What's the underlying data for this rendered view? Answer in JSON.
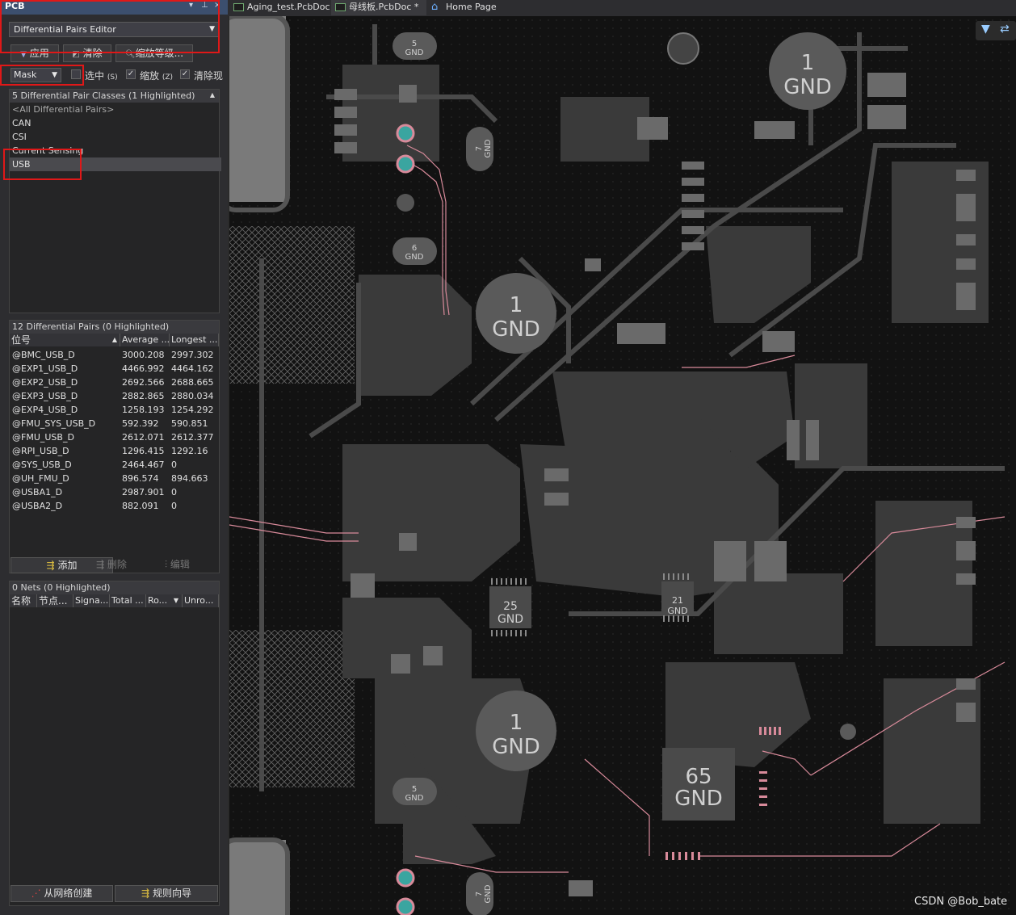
{
  "panel": {
    "title": "PCB",
    "mode_select": "Differential Pairs Editor",
    "buttons": {
      "apply": "应用",
      "clear": "清除",
      "zoom_level": "缩放等级..."
    },
    "mask_select": "Mask",
    "checkboxes": {
      "select_label": "选中",
      "select_key": "(S)",
      "zoom_label": "缩放",
      "zoom_key": "(Z)",
      "clear_label": "清除现"
    },
    "classes": {
      "header": "5 Differential Pair Classes (1 Highlighted)",
      "items": [
        "<All Differential Pairs>",
        "CAN",
        "CSI",
        "Current Sensing",
        "USB"
      ]
    },
    "pairs": {
      "header": "12 Differential Pairs (0 Highlighted)",
      "columns": [
        "位号",
        "Average ...",
        "Longest ..."
      ],
      "rows": [
        {
          "name": "@BMC_USB_D",
          "avg": "3000.208",
          "longest": "2997.302"
        },
        {
          "name": "@EXP1_USB_D",
          "avg": "4466.992",
          "longest": "4464.162"
        },
        {
          "name": "@EXP2_USB_D",
          "avg": "2692.566",
          "longest": "2688.665"
        },
        {
          "name": "@EXP3_USB_D",
          "avg": "2882.865",
          "longest": "2880.034"
        },
        {
          "name": "@EXP4_USB_D",
          "avg": "1258.193",
          "longest": "1254.292"
        },
        {
          "name": "@FMU_SYS_USB_D",
          "avg": "592.392",
          "longest": "590.851"
        },
        {
          "name": "@FMU_USB_D",
          "avg": "2612.071",
          "longest": "2612.377"
        },
        {
          "name": "@RPI_USB_D",
          "avg": "1296.415",
          "longest": "1292.16"
        },
        {
          "name": "@SYS_USB_D",
          "avg": "2464.467",
          "longest": "0"
        },
        {
          "name": "@UH_FMU_D",
          "avg": "896.574",
          "longest": "894.663"
        },
        {
          "name": "@USBA1_D",
          "avg": "2987.901",
          "longest": "0"
        },
        {
          "name": "@USBA2_D",
          "avg": "882.091",
          "longest": "0"
        }
      ],
      "add": "添加",
      "delete": "删除",
      "edit": "编辑"
    },
    "nets": {
      "header": "0 Nets (0 Highlighted)",
      "columns": [
        "名称",
        "节点...",
        "Signa...",
        "Total ...",
        "Ro...",
        "Unro..."
      ],
      "create_from_nets": "从网络创建",
      "rule_wizard": "规则向导"
    }
  },
  "tabs": [
    {
      "label": "Aging_test.PcbDoc",
      "icon": "pcb-doc-icon"
    },
    {
      "label": "母线板.PcbDoc *",
      "icon": "pcb-doc-icon"
    },
    {
      "label": "Home Page",
      "icon": "home-icon"
    }
  ],
  "board": {
    "gnd_labels": [
      {
        "num": "1",
        "text": "GND"
      },
      {
        "num": "1",
        "text": "GND"
      },
      {
        "num": "1",
        "text": "GND"
      },
      {
        "num": "25",
        "text": "GND"
      },
      {
        "num": "21",
        "text": "GND"
      },
      {
        "num": "65",
        "text": "GND"
      },
      {
        "num": "5",
        "text": "GND"
      },
      {
        "num": "6",
        "text": "GND"
      },
      {
        "num": "5",
        "text": "GND"
      },
      {
        "num": "7",
        "text": "GND"
      },
      {
        "num": "7",
        "text": "GND"
      }
    ],
    "watermark": "CSDN @Bob_bate"
  },
  "colors": {
    "highlight_red": "#e01818",
    "pad_teal": "#3aa5a0",
    "trace_pink": "#d88a9a"
  }
}
